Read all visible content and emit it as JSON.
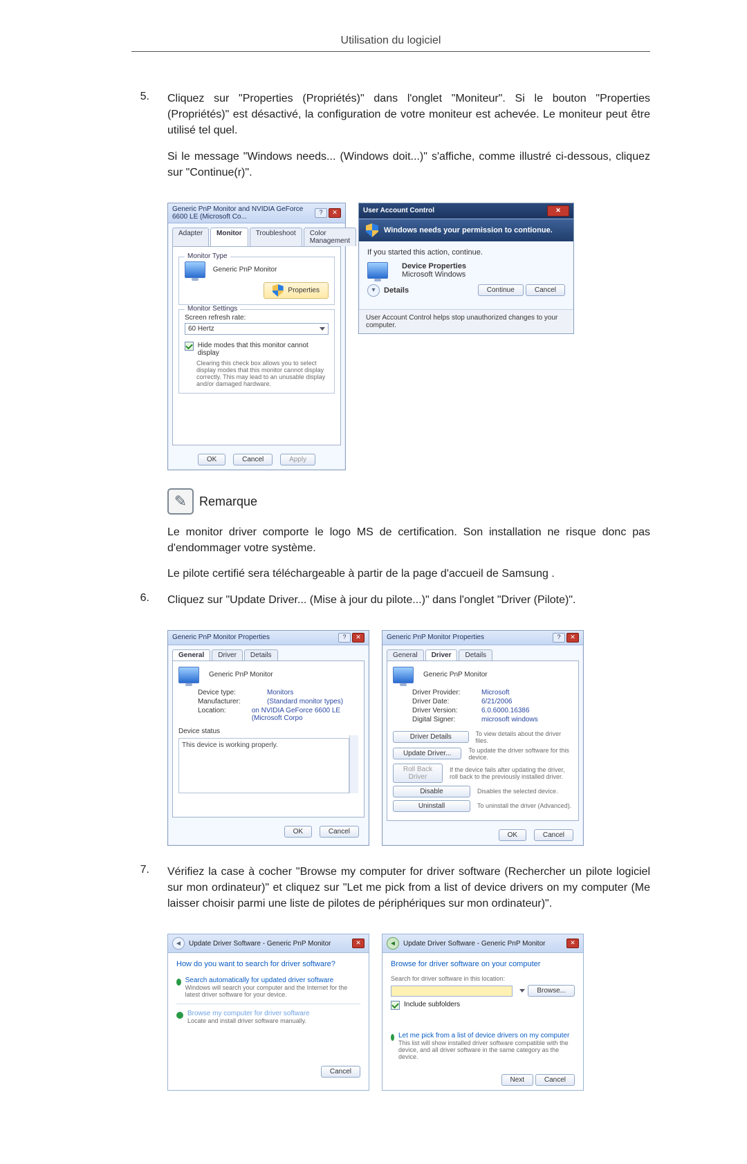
{
  "header": {
    "title": "Utilisation du logiciel"
  },
  "steps": {
    "s5": {
      "num": "5.",
      "para1": "Cliquez sur \"Properties (Propriétés)\" dans l'onglet \"Moniteur\". Si le bouton \"Properties (Propriétés)\" est désactivé, la configuration de votre moniteur est achevée. Le moniteur peut être utilisé tel quel.",
      "para2": "Si le message \"Windows needs... (Windows doit...)\" s'affiche, comme illustré ci-dessous, cliquez sur \"Continue(r)\"."
    },
    "s6": {
      "num": "6.",
      "para1": "Cliquez sur \"Update Driver... (Mise à jour du pilote...)\" dans l'onglet \"Driver (Pilote)\"."
    },
    "s7": {
      "num": "7.",
      "para1": "Vérifiez la case à cocher \"Browse my computer for driver software (Rechercher un pilote logiciel sur mon ordinateur)\" et cliquez sur \"Let me pick from a list of device drivers on my computer (Me laisser choisir parmi une liste de pilotes de périphériques sur mon ordinateur)\"."
    }
  },
  "remark": {
    "label": "Remarque",
    "p1": "Le monitor driver comporte le logo MS de certification. Son installation ne risque donc pas d'endommager votre système.",
    "p2": "Le pilote certifié sera téléchargeable à partir de la page d'accueil de Samsung ."
  },
  "dlg_monitor": {
    "title": "Generic PnP Monitor and NVIDIA GeForce 6600 LE (Microsoft Co...",
    "tabs": {
      "adapter": "Adapter",
      "monitor": "Monitor",
      "troubleshoot": "Troubleshoot",
      "color": "Color Management"
    },
    "group_type": "Monitor Type",
    "mon_name": "Generic PnP Monitor",
    "btn_properties": "Properties",
    "group_settings": "Monitor Settings",
    "refresh_label": "Screen refresh rate:",
    "refresh_value": "60 Hertz",
    "hide_modes": "Hide modes that this monitor cannot display",
    "hide_modes_desc": "Clearing this check box allows you to select display modes that this monitor cannot display correctly. This may lead to an unusable display and/or damaged hardware.",
    "ok": "OK",
    "cancel": "Cancel",
    "apply": "Apply"
  },
  "dlg_uac": {
    "title": "User Account Control",
    "banner": "Windows needs your permission to contionue.",
    "started": "If you started this action, continue.",
    "item_title": "Device Properties",
    "item_pub": "Microsoft Windows",
    "details": "Details",
    "continue": "Continue",
    "cancel": "Cancel",
    "footer": "User Account Control helps stop unauthorized changes to your computer."
  },
  "dlg_general": {
    "title": "Generic PnP Monitor Properties",
    "tabs": {
      "general": "General",
      "driver": "Driver",
      "details": "Details"
    },
    "name": "Generic PnP Monitor",
    "devtype_k": "Device type:",
    "devtype_v": "Monitors",
    "manu_k": "Manufacturer:",
    "manu_v": "(Standard monitor types)",
    "loc_k": "Location:",
    "loc_v": "on NVIDIA GeForce 6600 LE (Microsoft Corpo",
    "status_label": "Device status",
    "status_text": "This device is working properly.",
    "ok": "OK",
    "cancel": "Cancel"
  },
  "dlg_driver": {
    "title": "Generic PnP Monitor Properties",
    "tabs": {
      "general": "General",
      "driver": "Driver",
      "details": "Details"
    },
    "name": "Generic PnP Monitor",
    "prov_k": "Driver Provider:",
    "prov_v": "Microsoft",
    "date_k": "Driver Date:",
    "date_v": "6/21/2006",
    "ver_k": "Driver Version:",
    "ver_v": "6.0.6000.16386",
    "sign_k": "Digital Signer:",
    "sign_v": "microsoft windows",
    "btn_details": "Driver Details",
    "btn_details_desc": "To view details about the driver files.",
    "btn_update": "Update Driver...",
    "btn_update_desc": "To update the driver software for this device.",
    "btn_rollback": "Roll Back Driver",
    "btn_rollback_desc": "If the device fails after updating the driver, roll back to the previously installed driver.",
    "btn_disable": "Disable",
    "btn_disable_desc": "Disables the selected device.",
    "btn_uninstall": "Uninstall",
    "btn_uninstall_desc": "To uninstall the driver (Advanced).",
    "ok": "OK",
    "cancel": "Cancel"
  },
  "dlg_search": {
    "title": "Update Driver Software - Generic PnP Monitor",
    "heading": "How do you want to search for driver software?",
    "opt1_title": "Search automatically for updated driver software",
    "opt1_desc": "Windows will search your computer and the Internet for the latest driver software for your device.",
    "opt2_title": "Browse my computer for driver software",
    "opt2_desc": "Locate and install driver software manually.",
    "cancel": "Cancel"
  },
  "dlg_browse": {
    "title": "Update Driver Software - Generic PnP Monitor",
    "heading": "Browse for driver software on your computer",
    "search_label": "Search for driver software in this location:",
    "browse": "Browse...",
    "include": "Include subfolders",
    "pick_title": "Let me pick from a list of device drivers on my computer",
    "pick_desc": "This list will show installed driver software compatible with the device, and all driver software in the same category as the device.",
    "next": "Next",
    "cancel": "Cancel"
  }
}
